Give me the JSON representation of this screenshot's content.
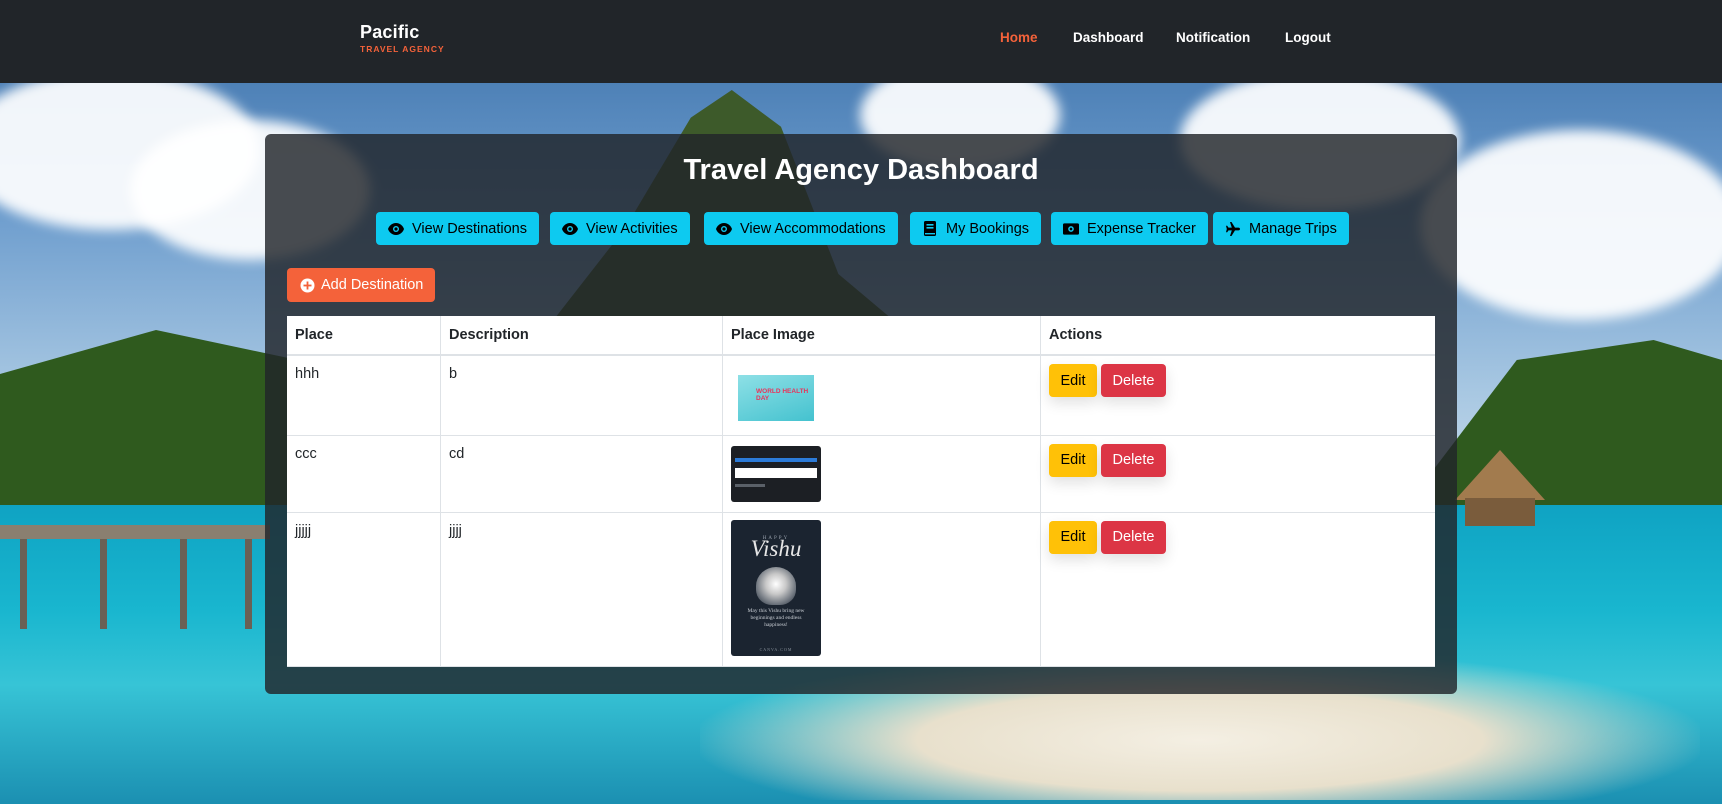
{
  "navbar": {
    "brand_name": "Pacific",
    "brand_sub": "TRAVEL AGENCY",
    "links": [
      {
        "label": "Home",
        "active": true
      },
      {
        "label": "Dashboard",
        "active": false
      },
      {
        "label": "Notification",
        "active": false
      },
      {
        "label": "Logout",
        "active": false
      }
    ]
  },
  "main": {
    "title": "Travel Agency Dashboard",
    "toolbar": [
      {
        "label": "View Destinations",
        "icon": "eye-icon"
      },
      {
        "label": "View Activities",
        "icon": "eye-icon"
      },
      {
        "label": "View Accommodations",
        "icon": "eye-icon"
      },
      {
        "label": "My Bookings",
        "icon": "book-icon"
      },
      {
        "label": "Expense Tracker",
        "icon": "money-icon"
      },
      {
        "label": "Manage Trips",
        "icon": "plane-icon"
      }
    ],
    "add_button": {
      "label": "Add Destination",
      "icon": "plus-circle-icon"
    },
    "table": {
      "headers": [
        "Place",
        "Description",
        "Place Image",
        "Actions"
      ],
      "rows": [
        {
          "place": "hhh",
          "description": "b",
          "image": "world-health-day-poster",
          "image_text": "WORLD HEALTH DAY"
        },
        {
          "place": "ccc",
          "description": "cd",
          "image": "website-screenshot"
        },
        {
          "place": "jjjjj",
          "description": "jjjj",
          "image": "happy-vishu-poster",
          "image_happy": "HAPPY",
          "image_title": "Vishu",
          "image_msg": "May this Vishu bring new beginnings and endless happiness!",
          "image_foot": "CANVA.COM"
        }
      ],
      "edit_label": "Edit",
      "delete_label": "Delete"
    }
  },
  "colors": {
    "navbar_bg": "#212529",
    "accent": "#f4623a",
    "info": "#0dcaf0",
    "warning": "#ffc107",
    "danger": "#dc3545"
  }
}
